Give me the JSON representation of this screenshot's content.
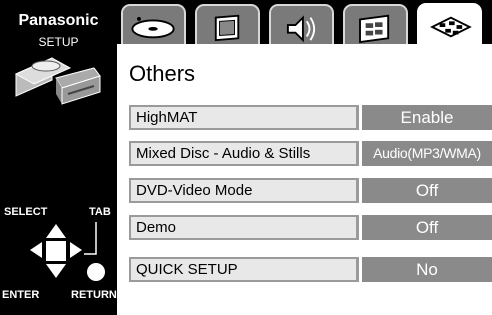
{
  "sidebar": {
    "brand": "Panasonic",
    "mode": "SETUP",
    "nav": {
      "select": "SELECT",
      "tab": "TAB",
      "enter": "ENTER",
      "return": "RETURN"
    }
  },
  "tabs": [
    {
      "name": "disc-icon"
    },
    {
      "name": "video-icon"
    },
    {
      "name": "audio-icon"
    },
    {
      "name": "display-icon"
    },
    {
      "name": "others-icon",
      "active": true
    }
  ],
  "page": {
    "title": "Others",
    "rows": [
      {
        "label": "HighMAT",
        "value": "Enable"
      },
      {
        "label": "Mixed Disc - Audio & Stills",
        "value": "Audio(MP3/WMA)"
      },
      {
        "label": "DVD-Video Mode",
        "value": "Off"
      },
      {
        "label": "Demo",
        "value": "Off"
      },
      {
        "label": "QUICK SETUP",
        "value": "No"
      }
    ]
  },
  "colors": {
    "background": "#000000",
    "panel": "#ffffff",
    "value_box": "#8a8a8a",
    "label_box": "#e8e8e8",
    "tab_inactive": "#7a7a7a"
  }
}
